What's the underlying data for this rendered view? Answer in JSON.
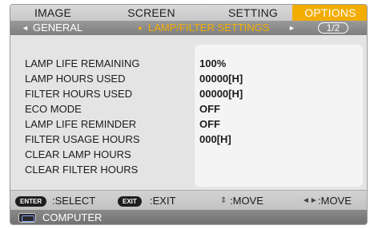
{
  "tabs": [
    {
      "label": "IMAGE"
    },
    {
      "label": "SCREEN"
    },
    {
      "label": "SETTING"
    },
    {
      "label": "OPTIONS",
      "active": true
    }
  ],
  "subtabs": {
    "left_arrow": "◄",
    "general": "GENERAL",
    "active_dot": "●",
    "current": "LAMP/FILTER SETTINGS",
    "right_arrow": "►",
    "page": "1/2"
  },
  "items": [
    {
      "label": "LAMP LIFE REMAINING",
      "value": "100%"
    },
    {
      "label": "LAMP HOURS USED",
      "value": "00000[H]"
    },
    {
      "label": "FILTER HOURS USED",
      "value": "00000[H]"
    },
    {
      "label": "ECO MODE",
      "value": "OFF"
    },
    {
      "label": "LAMP LIFE REMINDER",
      "value": "OFF"
    },
    {
      "label": "FILTER USAGE HOURS",
      "value": "000[H]"
    },
    {
      "label": "CLEAR LAMP HOURS",
      "value": ""
    },
    {
      "label": "CLEAR FILTER HOURS",
      "value": ""
    }
  ],
  "footer": {
    "enter_key": "ENTER",
    "enter_action": ":SELECT",
    "exit_key": "EXIT",
    "exit_action": ":EXIT",
    "updown_icon": "⇕",
    "updown_action": ":MOVE",
    "leftright_icon": "◄►",
    "leftright_action": ":MOVE"
  },
  "source": {
    "label": "COMPUTER",
    "icon": "computer-icon"
  },
  "colors": {
    "accent": "#f2ad00",
    "active_tab_text": "#ffffff"
  }
}
